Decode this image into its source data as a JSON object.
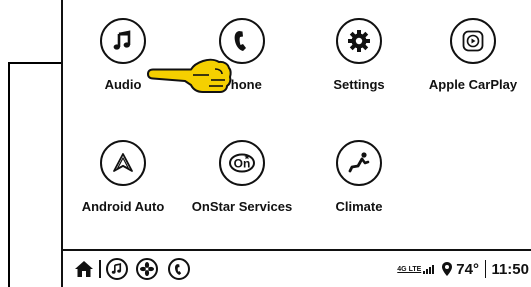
{
  "home_screen": {
    "apps": [
      {
        "label": "Audio",
        "icon": "music-note-icon"
      },
      {
        "label": "Phone",
        "icon": "phone-icon"
      },
      {
        "label": "Settings",
        "icon": "gear-icon"
      },
      {
        "label": "Apple CarPlay",
        "icon": "carplay-icon"
      },
      {
        "label": "Android Auto",
        "icon": "android-auto-icon"
      },
      {
        "label": "OnStar Services",
        "icon": "onstar-icon"
      },
      {
        "label": "Climate",
        "icon": "climate-seat-icon"
      }
    ],
    "onstar_glyph": "On",
    "pointer_icon": "pointing-hand-icon"
  },
  "status_bar": {
    "shortcuts": [
      "home-icon",
      "music-note-icon",
      "fan-icon",
      "phone-icon"
    ],
    "network": "4G LTE",
    "temperature": "74°",
    "time": "11:50"
  },
  "colors": {
    "pointer_fill": "#f5d000",
    "outline": "#111111"
  }
}
